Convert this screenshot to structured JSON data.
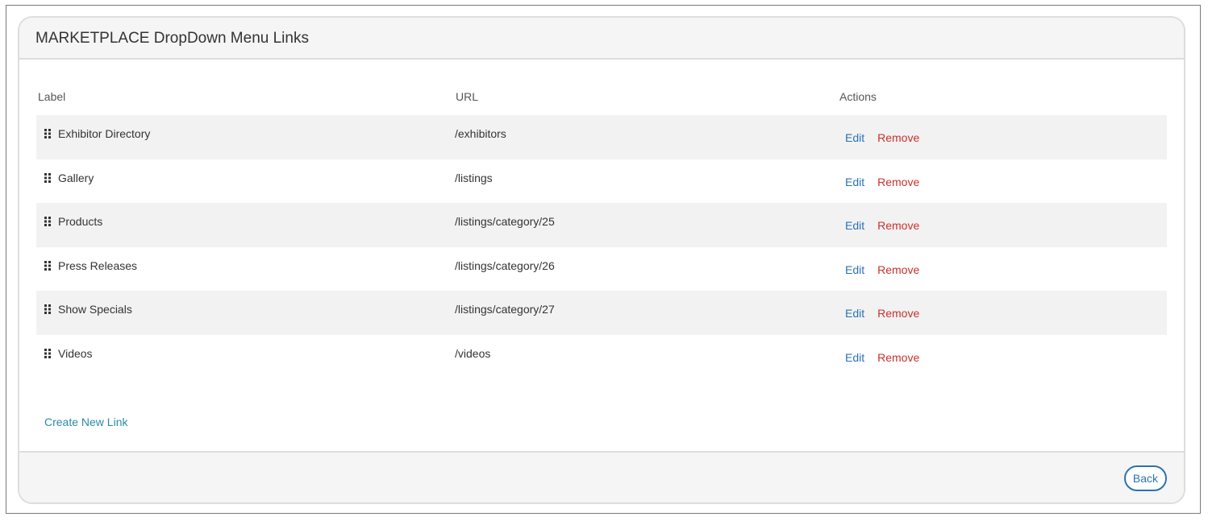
{
  "panel": {
    "title": "MARKETPLACE DropDown Menu Links"
  },
  "table": {
    "headers": {
      "label": "Label",
      "url": "URL",
      "actions": "Actions"
    },
    "rows": [
      {
        "label": "Exhibitor Directory",
        "url": "/exhibitors",
        "edit": "Edit",
        "remove": "Remove"
      },
      {
        "label": "Gallery",
        "url": "/listings",
        "edit": "Edit",
        "remove": "Remove"
      },
      {
        "label": "Products",
        "url": "/listings/category/25",
        "edit": "Edit",
        "remove": "Remove"
      },
      {
        "label": "Press Releases",
        "url": "/listings/category/26",
        "edit": "Edit",
        "remove": "Remove"
      },
      {
        "label": "Show Specials",
        "url": "/listings/category/27",
        "edit": "Edit",
        "remove": "Remove"
      },
      {
        "label": "Videos",
        "url": "/videos",
        "edit": "Edit",
        "remove": "Remove"
      }
    ]
  },
  "create_link_label": "Create New Link",
  "footer": {
    "back_label": "Back"
  },
  "icons": {
    "row_handle": "drag-handle-icon"
  },
  "colors": {
    "link_blue": "#2a72b5",
    "remove_red": "#c9302c",
    "create_link": "#2a8aa8",
    "stripe": "#f2f2f2",
    "panel_bg": "#f5f5f5"
  }
}
